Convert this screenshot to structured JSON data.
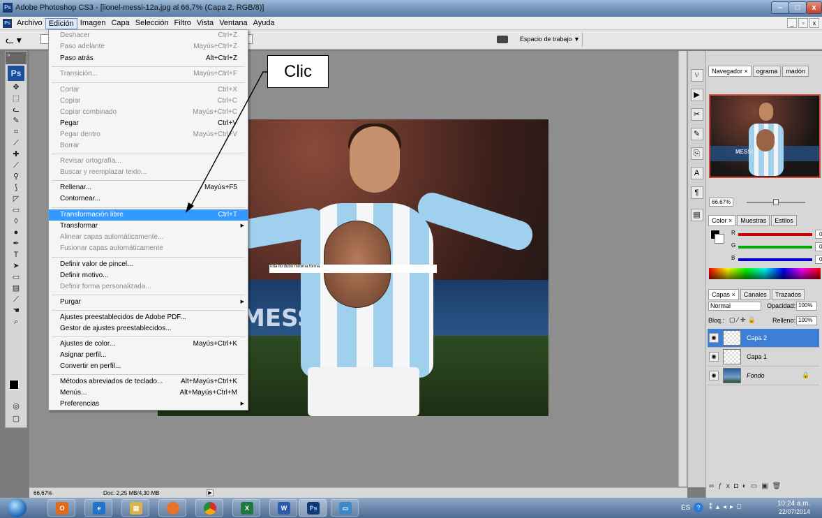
{
  "window": {
    "title": "Adobe Photoshop CS3 - [lionel-messi-12a.jpg al 66,7% (Capa 2, RGB/8)]",
    "app_icon_text": "Ps",
    "minimize": "–",
    "maximize": "□",
    "close": "x"
  },
  "menubar": {
    "items": [
      "Archivo",
      "Edición",
      "Imagen",
      "Capa",
      "Selección",
      "Filtro",
      "Vista",
      "Ventana",
      "Ayuda"
    ],
    "active": "Edición",
    "mdi_buttons": [
      "_",
      "▫",
      "x"
    ]
  },
  "optionsbar": {
    "tool_icon": "lasso-icon",
    "workspace_label": "Espacio de trabajo ▼"
  },
  "toolbox": {
    "logo": "Ps",
    "tools": [
      "move",
      "marquee",
      "lasso",
      "quick-selection",
      "crop",
      "slice",
      "healing",
      "brush",
      "clone-stamp",
      "history-brush",
      "eraser",
      "gradient",
      "blur",
      "dodge",
      "pen",
      "type",
      "path-selection",
      "rectangle",
      "notes",
      "eyedropper",
      "hand",
      "zoom"
    ]
  },
  "edit_menu": {
    "items": [
      {
        "label": "Deshacer",
        "shortcut": "Ctrl+Z",
        "disabled": true
      },
      {
        "label": "Paso adelante",
        "shortcut": "Mayús+Ctrl+Z",
        "disabled": true
      },
      {
        "label": "Paso atrás",
        "shortcut": "Alt+Ctrl+Z",
        "disabled": false
      },
      {
        "label": "Transición...",
        "shortcut": "Mayús+Ctrl+F",
        "disabled": true
      },
      {
        "label": "Cortar",
        "shortcut": "Ctrl+X",
        "disabled": true
      },
      {
        "label": "Copiar",
        "shortcut": "Ctrl+C",
        "disabled": true
      },
      {
        "label": "Copiar combinado",
        "shortcut": "Mayús+Ctrl+C",
        "disabled": true
      },
      {
        "label": "Pegar",
        "shortcut": "Ctrl+V",
        "disabled": false
      },
      {
        "label": "Pegar dentro",
        "shortcut": "Mayús+Ctrl+V",
        "disabled": true
      },
      {
        "label": "Borrar",
        "shortcut": "",
        "disabled": true
      },
      {
        "label": "Revisar ortografía...",
        "shortcut": "",
        "disabled": true
      },
      {
        "label": "Buscar y reemplazar texto...",
        "shortcut": "",
        "disabled": true
      },
      {
        "label": "Rellenar...",
        "shortcut": "Mayús+F5",
        "disabled": false
      },
      {
        "label": "Contornear...",
        "shortcut": "",
        "disabled": false
      },
      {
        "label": "Transformación libre",
        "shortcut": "Ctrl+T",
        "disabled": false,
        "highlighted": true
      },
      {
        "label": "Transformar",
        "shortcut": "",
        "disabled": false,
        "submenu": true
      },
      {
        "label": "Alinear capas automáticamente...",
        "shortcut": "",
        "disabled": true
      },
      {
        "label": "Fusionar capas automáticamente",
        "shortcut": "",
        "disabled": true
      },
      {
        "label": "Definir valor de pincel...",
        "shortcut": "",
        "disabled": false
      },
      {
        "label": "Definir motivo...",
        "shortcut": "",
        "disabled": false
      },
      {
        "label": "Definir forma personalizada...",
        "shortcut": "",
        "disabled": true
      },
      {
        "label": "Purgar",
        "shortcut": "",
        "disabled": false,
        "submenu": true
      },
      {
        "label": "Ajustes preestablecidos de Adobe PDF...",
        "shortcut": "",
        "disabled": false
      },
      {
        "label": "Gestor de ajustes preestablecidos...",
        "shortcut": "",
        "disabled": false
      },
      {
        "label": "Ajustes de color...",
        "shortcut": "Mayús+Ctrl+K",
        "disabled": false
      },
      {
        "label": "Asignar perfil...",
        "shortcut": "",
        "disabled": false
      },
      {
        "label": "Convertir en perfil...",
        "shortcut": "",
        "disabled": false
      },
      {
        "label": "Métodos abreviados de teclado...",
        "shortcut": "Alt+Mayús+Ctrl+K",
        "disabled": false
      },
      {
        "label": "Menús...",
        "shortcut": "Alt+Mayús+Ctrl+M",
        "disabled": false
      },
      {
        "label": "Preferencias",
        "shortcut": "",
        "disabled": false,
        "submenu": true
      }
    ]
  },
  "annotation": {
    "text": "Clic"
  },
  "document": {
    "photo_text": "MESSI",
    "caption": "Tota llo dubo mínima forma"
  },
  "statusbar": {
    "zoom": "66,67%",
    "doc_info": "Doc: 2,25 MB/4,30 MB"
  },
  "navigator": {
    "tabs": [
      "Navegador ×",
      "ograma",
      "madón"
    ],
    "zoom": "66.67%",
    "zoom_level_fraction": 0.5,
    "thumb_text": "MESSI"
  },
  "color_panel": {
    "tabs": [
      "Color ×",
      "Muestras",
      "Estilos"
    ],
    "channels": [
      {
        "label": "R",
        "value": "0",
        "color": "#cc0000"
      },
      {
        "label": "G",
        "value": "0",
        "color": "#00aa00"
      },
      {
        "label": "B",
        "value": "0",
        "color": "#0000cc"
      }
    ]
  },
  "layers_panel": {
    "tabs": [
      "Capas ×",
      "Canales",
      "Trazados"
    ],
    "blend_mode": "Normal",
    "opacity_label": "Opacidad:",
    "opacity_value": "100%",
    "lock_label": "Bloq.:",
    "fill_label": "Relleno:",
    "fill_value": "100%",
    "layers": [
      {
        "name": "Capa 2",
        "selected": true
      },
      {
        "name": "Capa 1",
        "selected": false
      },
      {
        "name": "Fondo",
        "selected": false,
        "locked": true
      }
    ]
  },
  "taskbar": {
    "apps": [
      "outlook",
      "internet-explorer",
      "file-explorer",
      "firefox",
      "chrome",
      "excel",
      "word",
      "photoshop",
      "remote-desktop"
    ],
    "lang": "ES",
    "time": "10:24 a.m.",
    "date": "22/07/2014"
  },
  "colors": {
    "menu_highlight": "#3399ff",
    "layer_selected": "#3d7fd6"
  }
}
